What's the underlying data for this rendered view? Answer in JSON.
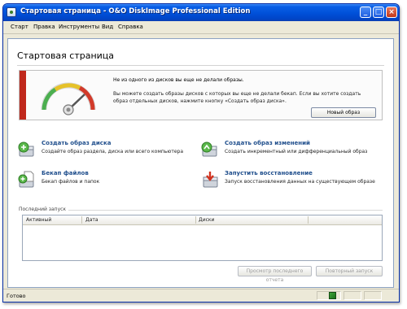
{
  "window": {
    "title": "Стартовая страница - O&O DiskImage Professional Edition",
    "minimize_glyph": "_",
    "maximize_glyph": "□",
    "close_glyph": "×"
  },
  "menu": [
    "Старт",
    "Правка",
    "Инструменты",
    "Вид",
    "Справка"
  ],
  "page": {
    "title": "Стартовая страница"
  },
  "banner": {
    "line1": "Не из одного из дисков вы еще не делали образы.",
    "line2": "Вы можете создать образы дисков с которых вы еще не делали бекап. Если вы хотите создать образ отдельных дисков, нажмите кнопку «Создать образ диска».",
    "button": "Новый образ",
    "accent_color": "#c0281c"
  },
  "actions": [
    {
      "title": "Создать образ диска",
      "desc": "Создайте образ раздела, диска или всего компьютера",
      "icon": "create-disk-image-icon"
    },
    {
      "title": "Создать образ изменений",
      "desc": "Создать инкрементный или дифференциальный образ",
      "icon": "incremental-image-icon"
    },
    {
      "title": "Бекап файлов",
      "desc": "Бекап файлов и папок",
      "icon": "file-backup-icon"
    },
    {
      "title": "Запустить восстановление",
      "desc": "Запуск восстановления данных на существующем образе",
      "icon": "restore-icon"
    }
  ],
  "last_run": {
    "label": "Последний запуск",
    "columns": [
      "Активный",
      "Дата",
      "Диски"
    ]
  },
  "buttons": {
    "view_last_report": "Просмотр последнего отчета",
    "repeat_last_run": "Повторный запуск"
  },
  "status": {
    "text": "Готово"
  }
}
